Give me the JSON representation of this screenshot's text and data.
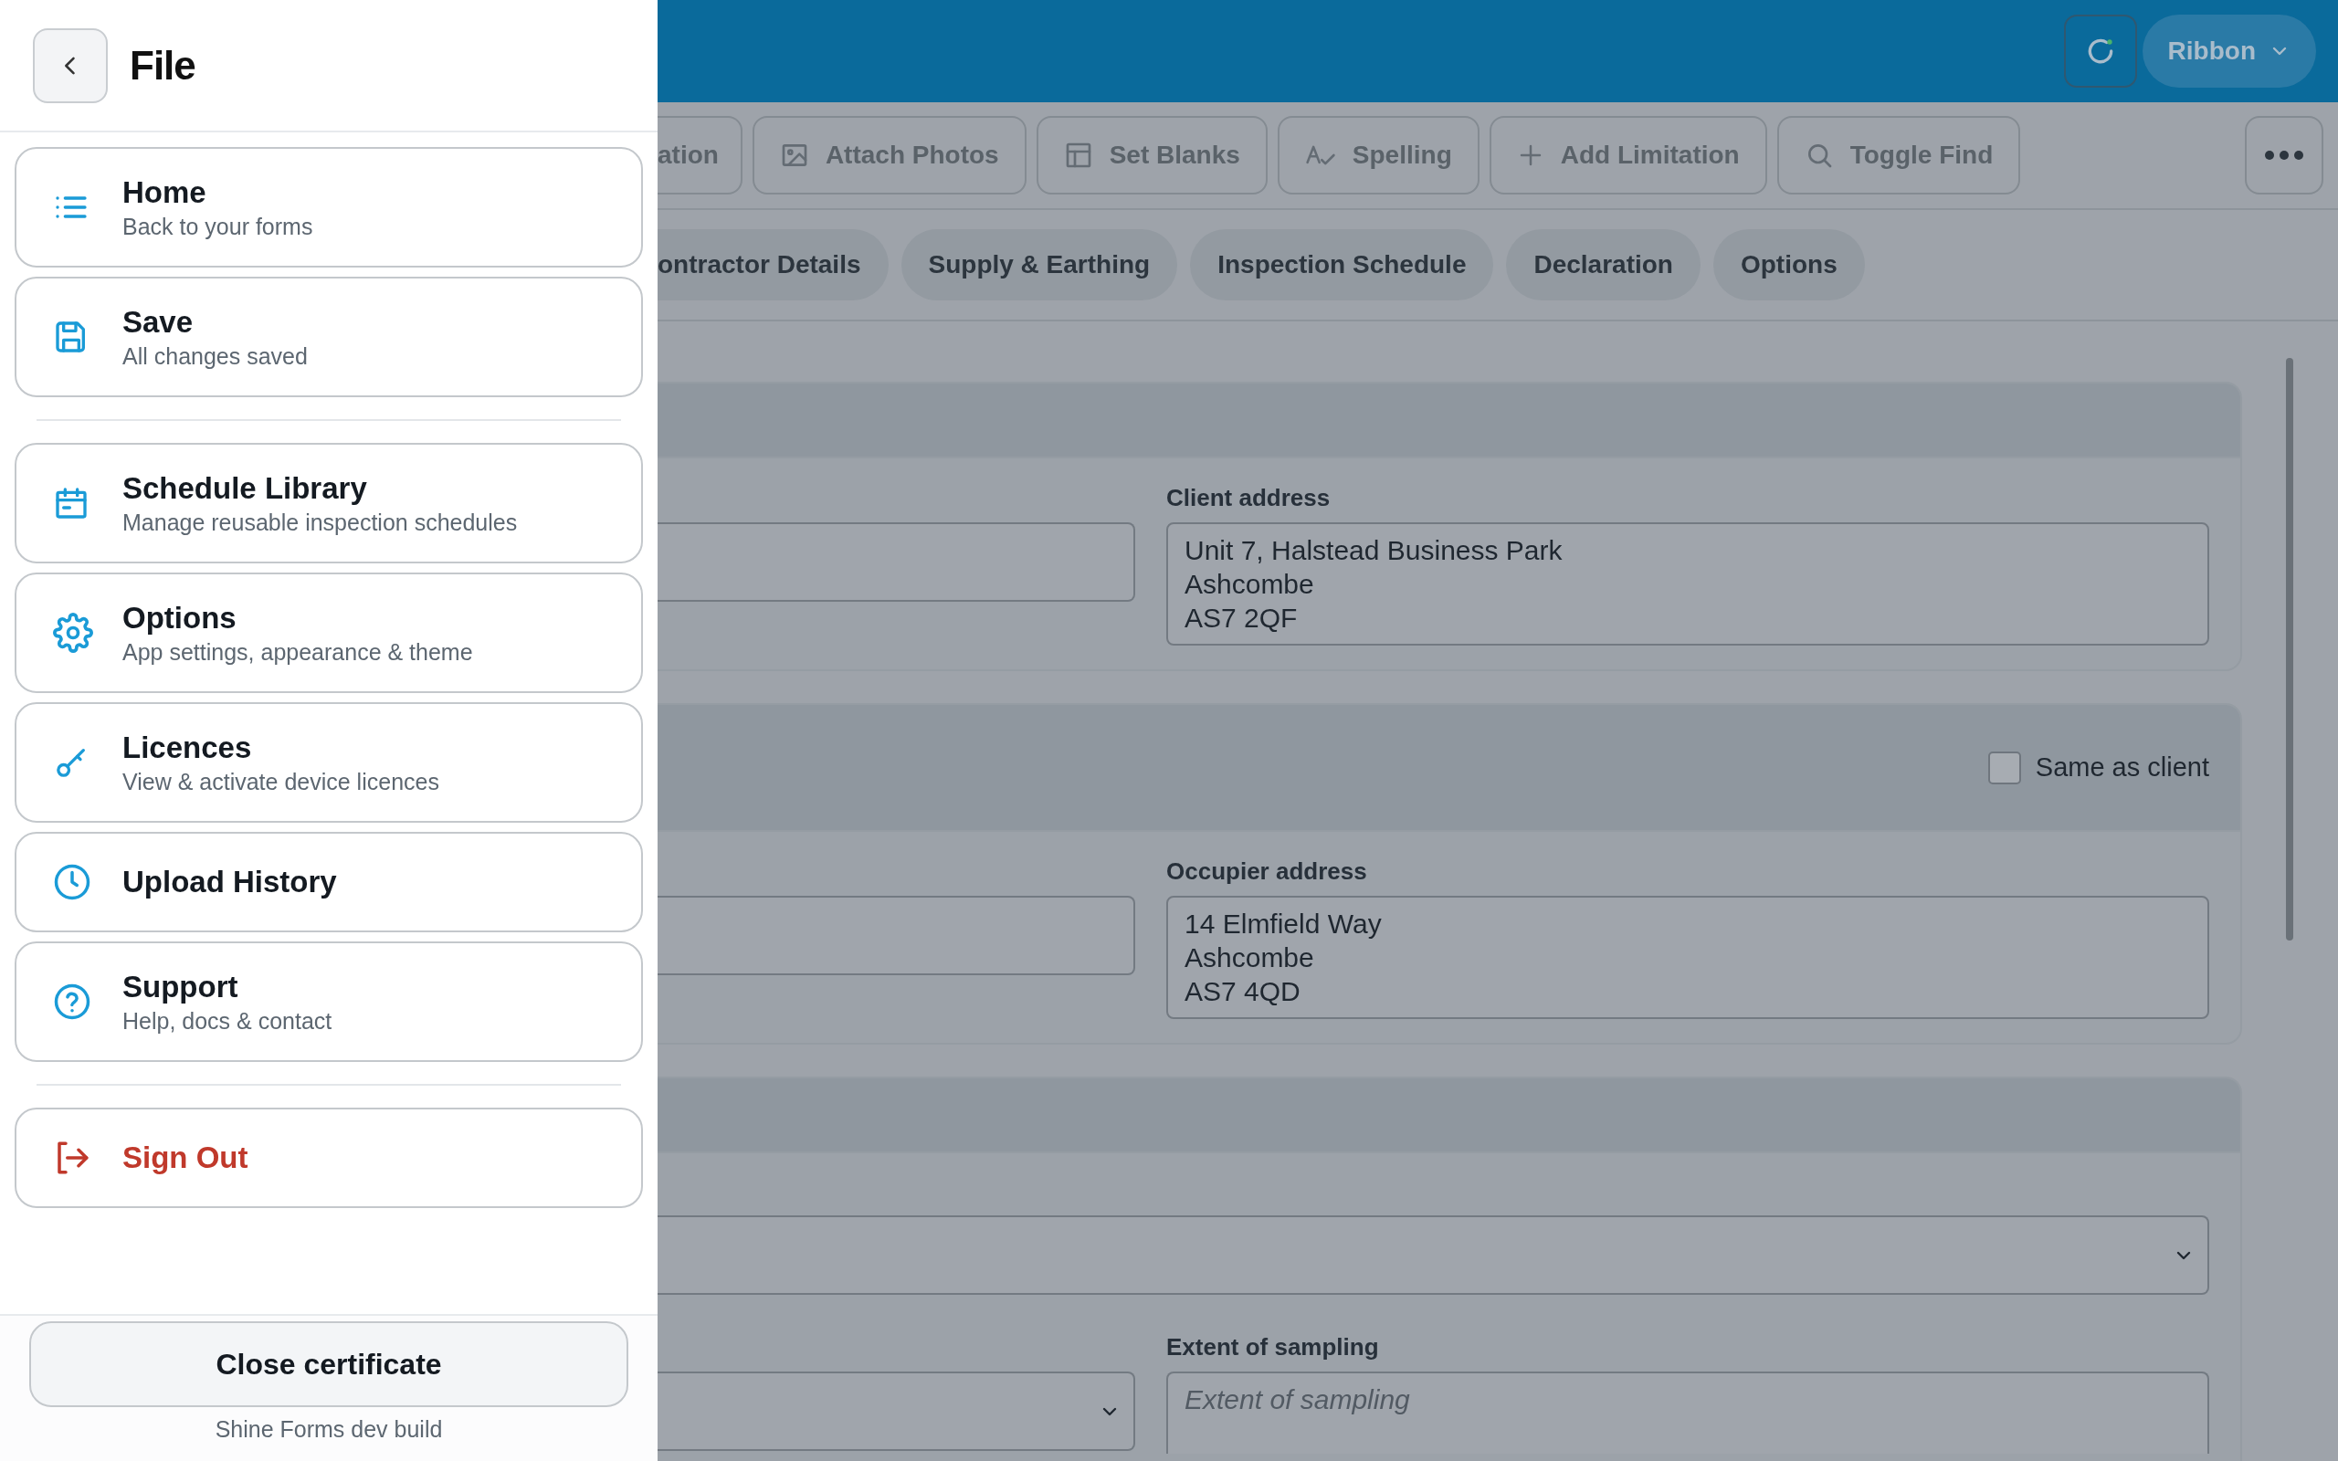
{
  "drawer": {
    "title": "File",
    "groups": [
      [
        {
          "kind": "list",
          "title": "Home",
          "subtitle": "Back to your forms"
        },
        {
          "kind": "save",
          "title": "Save",
          "subtitle": "All changes saved"
        }
      ],
      [
        {
          "kind": "calendar",
          "title": "Schedule Library",
          "subtitle": "Manage reusable inspection schedules"
        },
        {
          "kind": "gear",
          "title": "Options",
          "subtitle": "App settings, appearance & theme"
        },
        {
          "kind": "key",
          "title": "Licences",
          "subtitle": "View & activate device licences"
        },
        {
          "kind": "clock",
          "title": "Upload History"
        },
        {
          "kind": "help",
          "title": "Support",
          "subtitle": "Help, docs & contact"
        }
      ],
      [
        {
          "kind": "signout",
          "title": "Sign Out"
        }
      ]
    ],
    "close_button": "Close certificate",
    "build_label": "Shine Forms dev build"
  },
  "ribbon_button": "Ribbon",
  "toolbar": [
    {
      "kind": "none",
      "label": "ation"
    },
    {
      "kind": "image",
      "label": "Attach Photos"
    },
    {
      "kind": "table",
      "label": "Set Blanks"
    },
    {
      "kind": "spell",
      "label": "Spelling"
    },
    {
      "kind": "plus",
      "label": "Add Limitation"
    },
    {
      "kind": "search",
      "label": "Toggle Find"
    }
  ],
  "tabs": [
    {
      "label": "ontractor Details",
      "selected": false
    },
    {
      "label": "Supply & Earthing",
      "selected": false
    },
    {
      "label": "Inspection Schedule",
      "selected": false
    },
    {
      "label": "Declaration",
      "selected": false
    },
    {
      "label": "Options",
      "selected": false
    }
  ],
  "sections": [
    {
      "rows": [
        [
          {
            "kind": "input"
          },
          {
            "kind": "textarea",
            "label": "Client address",
            "value": "Unit 7, Halstead Business Park\nAshcombe\nAS7 2QF"
          }
        ]
      ]
    },
    {
      "header_checkbox": {
        "label": "Same as client",
        "checked": false
      },
      "rows": [
        [
          {
            "kind": "input"
          },
          {
            "kind": "textarea",
            "label": "Occupier address",
            "value": "14 Elmfield Way\nAshcombe\nAS7 4QD"
          }
        ]
      ]
    },
    {
      "rows": [
        [
          {
            "kind": "select_wide"
          }
        ],
        [
          {
            "kind": "select"
          },
          {
            "kind": "textarea",
            "label": "Extent of sampling",
            "placeholder": "Extent of sampling"
          }
        ]
      ]
    }
  ]
}
